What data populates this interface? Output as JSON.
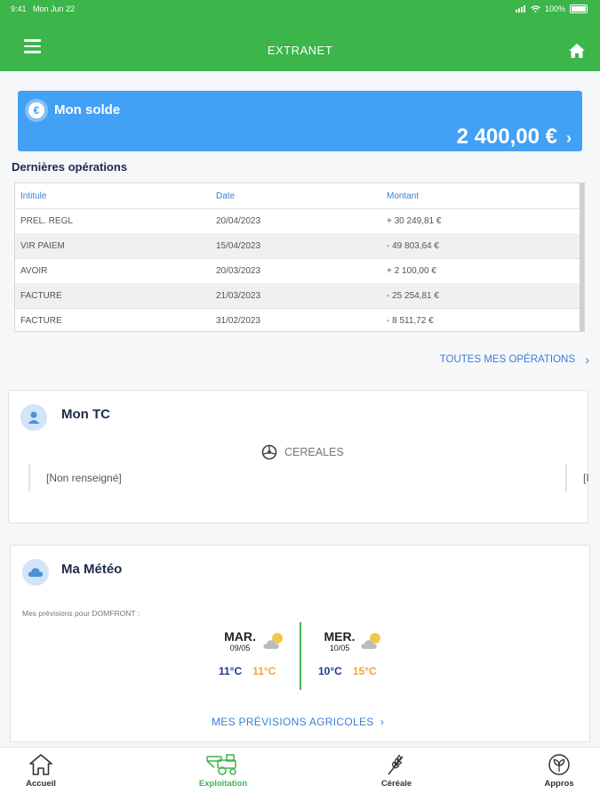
{
  "status_bar": {
    "time": "9:41",
    "date": "Mon Jun 22",
    "battery": "100%"
  },
  "header": {
    "title": "EXTRANET"
  },
  "balance": {
    "label": "Mon solde",
    "amount": "2 400,00 €",
    "currency_symbol": "€"
  },
  "operations": {
    "title": "Dernières opérations",
    "columns": [
      "Intitule",
      "Date",
      "Montant"
    ],
    "rows": [
      {
        "label": "PREL. REGL",
        "date": "20/04/2023",
        "amount": "+ 30 249,81 €"
      },
      {
        "label": "VIR PAIEM",
        "date": "15/04/2023",
        "amount": "- 49 803,64 €"
      },
      {
        "label": "AVOIR",
        "date": "20/03/2023",
        "amount": "+ 2 100,00 €"
      },
      {
        "label": "FACTURE",
        "date": "21/03/2023",
        "amount": "- 25 254,81 €"
      },
      {
        "label": "FACTURE",
        "date": "31/02/2023",
        "amount": "- 8 511,72 €"
      }
    ],
    "all_link": "TOUTES MES OPÉRATIONS"
  },
  "tc": {
    "title": "Mon TC",
    "category": "CEREALES",
    "value": "[Non renseigné]",
    "next_stub": "[I"
  },
  "meteo": {
    "title": "Ma Météo",
    "forecast_label": "Mes prévisions pour DOMFRONT :",
    "days": [
      {
        "name": "MAR.",
        "date": "09/05",
        "min": "11°C",
        "max": "11°C",
        "icon": "partly-cloudy-icon"
      },
      {
        "name": "MER.",
        "date": "10/05",
        "min": "10°C",
        "max": "15°C",
        "icon": "partly-cloudy-icon"
      }
    ],
    "link": "MES PRÉVISIONS AGRICOLES"
  },
  "tabbar": {
    "tabs": [
      {
        "label": "Accueil",
        "icon": "home-outline-icon",
        "active": false
      },
      {
        "label": "Exploitation",
        "icon": "harvester-icon",
        "active": true
      },
      {
        "label": "Céréale",
        "icon": "wheat-icon",
        "active": false
      },
      {
        "label": "Appros",
        "icon": "leaf-circle-icon",
        "active": false
      }
    ]
  },
  "colors": {
    "primary_green": "#3cb54a",
    "balance_blue": "#42a0f5",
    "link_blue": "#3a7fd6",
    "temp_min": "#1d3b8a",
    "temp_max": "#f2a33a"
  }
}
